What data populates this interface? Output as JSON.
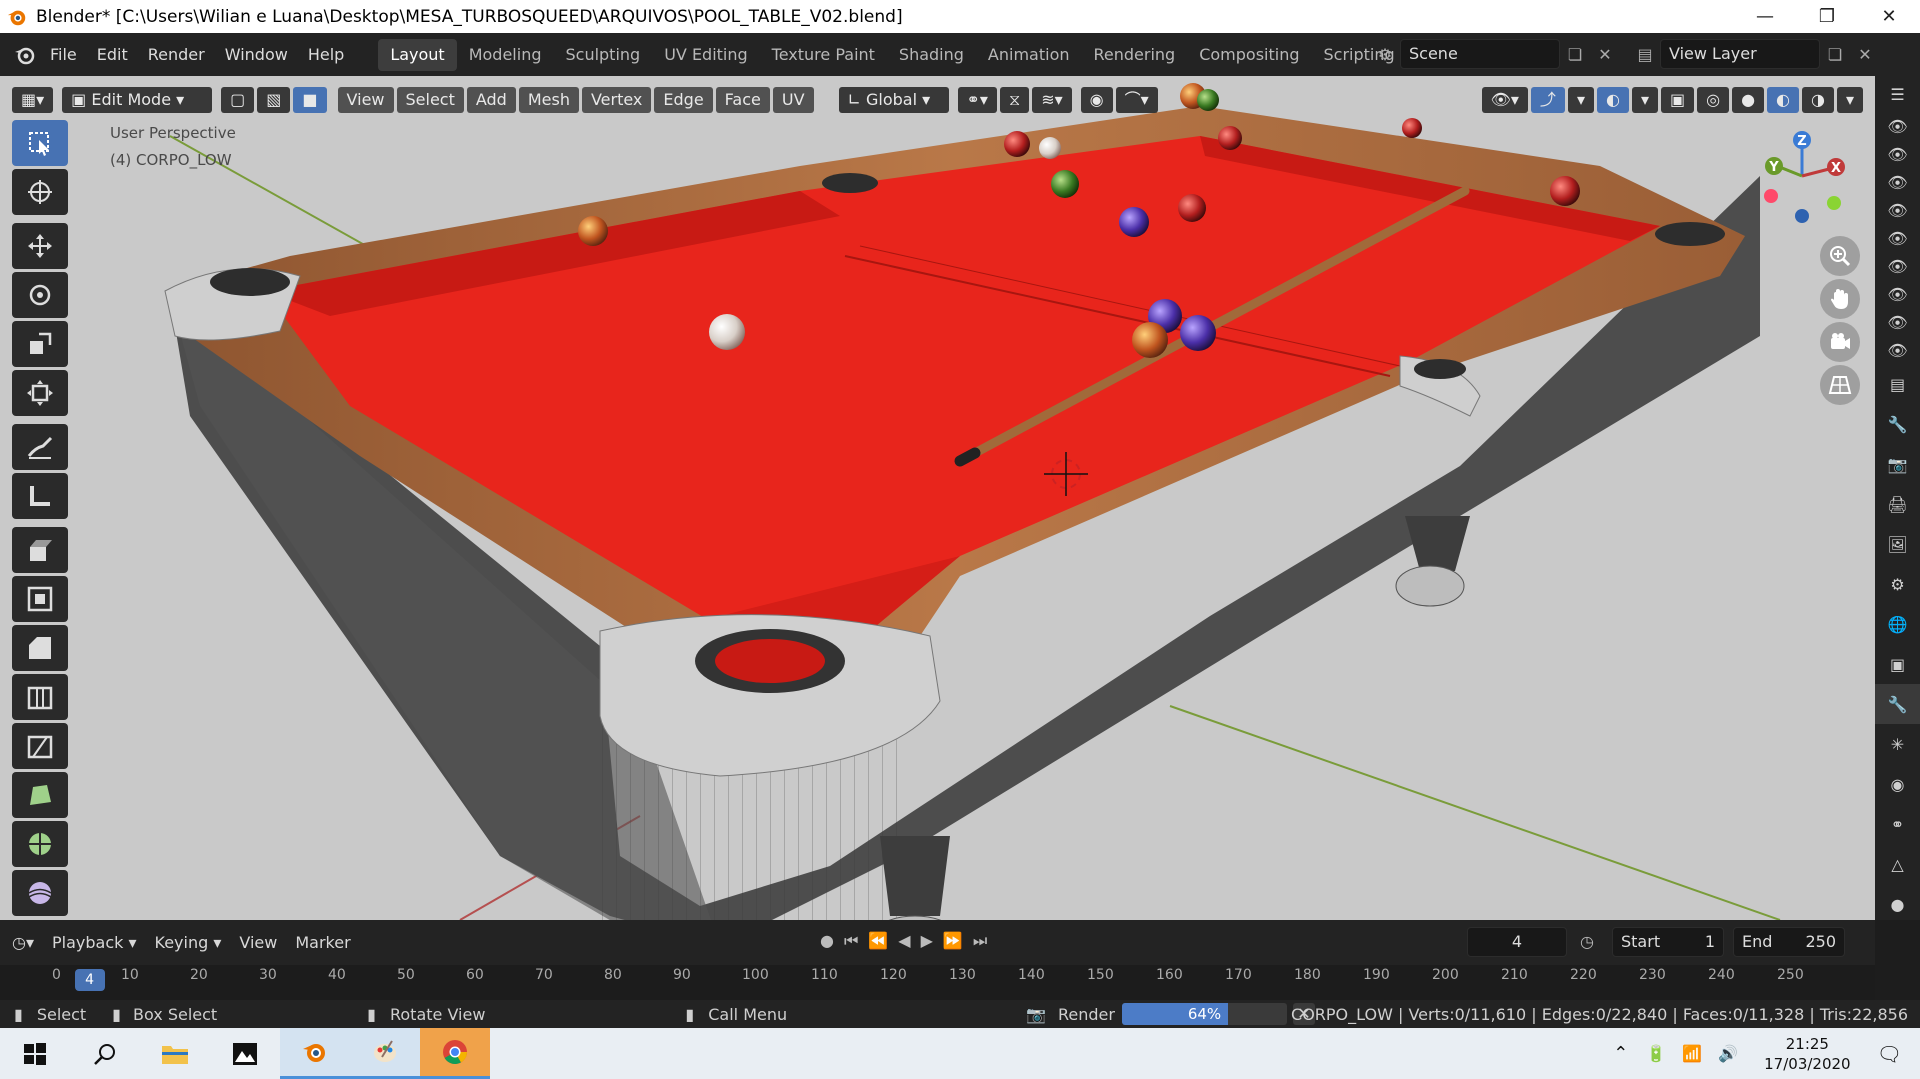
{
  "window": {
    "title": "Blender* [C:\\Users\\Wilian e Luana\\Desktop\\MESA_TURBOSQUEED\\ARQUIVOS\\POOL_TABLE_V02.blend]",
    "controls": [
      "minimize",
      "restore",
      "close"
    ]
  },
  "menu": [
    "File",
    "Edit",
    "Render",
    "Window",
    "Help"
  ],
  "workspaces": [
    "Layout",
    "Modeling",
    "Sculpting",
    "UV Editing",
    "Texture Paint",
    "Shading",
    "Animation",
    "Rendering",
    "Compositing",
    "Scripting"
  ],
  "active_workspace": "Layout",
  "scene": {
    "name": "Scene",
    "view_layer": "View Layer"
  },
  "viewport": {
    "mode": "Edit Mode",
    "menus": [
      "View",
      "Select",
      "Add",
      "Mesh",
      "Vertex",
      "Edge",
      "Face",
      "UV"
    ],
    "orientation": "Global",
    "perspective_label": "User Perspective",
    "object_label": "(4) CORPO_LOW",
    "gizmo_axes": [
      "Z",
      "Y",
      "X"
    ]
  },
  "colors": {
    "felt": "#e8251c",
    "wood": "#a8663c",
    "body": "#4a4a4a",
    "accent": "#4772b3",
    "background": "#c9c9c9"
  },
  "timeline": {
    "menus": [
      "Playback",
      "Keying",
      "View",
      "Marker"
    ],
    "current_frame": "4",
    "start_label": "Start",
    "start": "1",
    "end_label": "End",
    "end": "250",
    "ruler": [
      "0",
      "4",
      "10",
      "20",
      "30",
      "40",
      "50",
      "60",
      "70",
      "80",
      "90",
      "100",
      "110",
      "120",
      "130",
      "140",
      "150",
      "160",
      "170",
      "180",
      "190",
      "200",
      "210",
      "220",
      "230",
      "240",
      "250"
    ]
  },
  "status": {
    "select": "Select",
    "box_select": "Box Select",
    "rotate_view": "Rotate View",
    "call_menu": "Call Menu",
    "render_label": "Render",
    "render_progress": "64%",
    "render_fraction": 0.64,
    "stats": "CORPO_LOW | Verts:0/11,610 | Edges:0/22,840 | Faces:0/11,328 | Tris:22,856"
  },
  "taskbar": {
    "apps": [
      "windows-start",
      "search",
      "file-explorer",
      "photos",
      "blender",
      "paint",
      "chrome"
    ],
    "time": "21:25",
    "date": "17/03/2020"
  }
}
